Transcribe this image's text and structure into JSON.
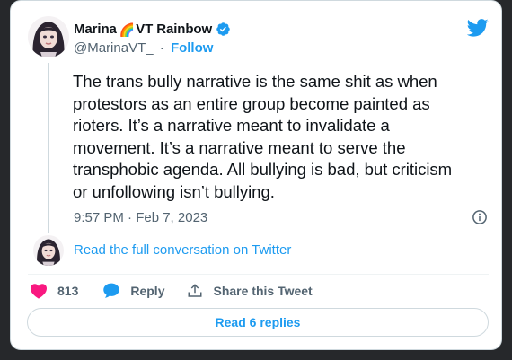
{
  "author": {
    "display_name": "Marina",
    "name_suffix": "VT Rainbow",
    "emoji": "🌈",
    "handle": "@MarinaVT_",
    "separator": "·",
    "follow_label": "Follow",
    "verified": true
  },
  "tweet": {
    "text": "The trans bully narrative is the same shit as when\nprotestors as an entire group become painted as\nrioters. It’s a narrative meant to invalidate a\nmovement. It’s a narrative meant to serve the\ntransphobic agenda. All bullying is bad, but criticism\nor unfollowing isn’t bullying.",
    "timestamp": "9:57 PM · Feb 7, 2023"
  },
  "conversation_link": "Read the full conversation on Twitter",
  "actions": {
    "like_count": "813",
    "reply_label": "Reply",
    "share_label": "Share this Tweet"
  },
  "read_replies_label": "Read 6 replies",
  "icons": {
    "verified": "verified-badge-icon",
    "brand": "twitter-bird-icon",
    "info": "info-icon",
    "like": "heart-icon",
    "reply": "reply-bubble-icon",
    "share": "share-upload-icon"
  },
  "colors": {
    "accent": "#1d9bf0",
    "like": "#f91880",
    "text_primary": "#0f1419",
    "text_secondary": "#536471",
    "border": "#cfd9de",
    "background": "#26282b"
  }
}
